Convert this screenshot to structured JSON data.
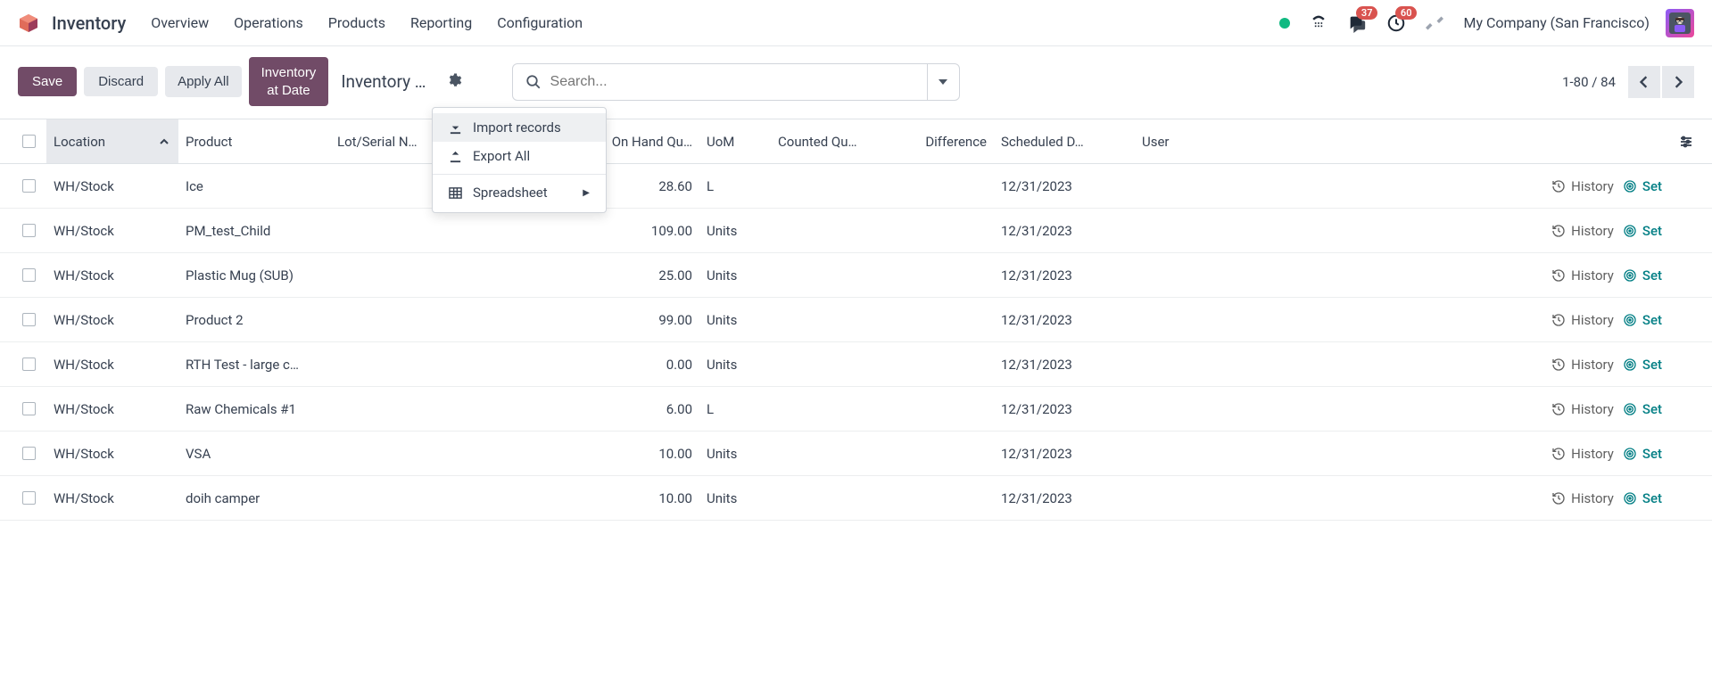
{
  "app_title": "Inventory",
  "nav": [
    "Overview",
    "Operations",
    "Products",
    "Reporting",
    "Configuration"
  ],
  "badges": {
    "messages": "37",
    "activities": "60"
  },
  "company": "My Company (San Francisco)",
  "toolbar": {
    "save": "Save",
    "discard": "Discard",
    "apply_all": "Apply All",
    "inventory_at_date": "Inventory at Date",
    "breadcrumb": "Inventory …"
  },
  "search": {
    "placeholder": "Search..."
  },
  "pager": {
    "text": "1-80 / 84"
  },
  "dropdown": {
    "import": "Import records",
    "export": "Export All",
    "spreadsheet": "Spreadsheet"
  },
  "columns": {
    "location": "Location",
    "product": "Product",
    "lot": "Lot/Serial N…",
    "onhand": "On Hand Qu…",
    "uom": "UoM",
    "counted": "Counted Qu…",
    "difference": "Difference",
    "scheduled": "Scheduled D…",
    "user": "User"
  },
  "row_actions": {
    "history": "History",
    "set": "Set"
  },
  "rows": [
    {
      "location": "WH/Stock",
      "product": "Ice",
      "qty": "28.60",
      "uom": "L",
      "date": "12/31/2023"
    },
    {
      "location": "WH/Stock",
      "product": "PM_test_Child",
      "qty": "109.00",
      "uom": "Units",
      "date": "12/31/2023"
    },
    {
      "location": "WH/Stock",
      "product": "Plastic Mug (SUB)",
      "qty": "25.00",
      "uom": "Units",
      "date": "12/31/2023"
    },
    {
      "location": "WH/Stock",
      "product": "Product 2",
      "qty": "99.00",
      "uom": "Units",
      "date": "12/31/2023"
    },
    {
      "location": "WH/Stock",
      "product": "RTH Test - large c…",
      "qty": "0.00",
      "uom": "Units",
      "date": "12/31/2023"
    },
    {
      "location": "WH/Stock",
      "product": "Raw Chemicals #1",
      "qty": "6.00",
      "uom": "L",
      "date": "12/31/2023"
    },
    {
      "location": "WH/Stock",
      "product": "VSA",
      "qty": "10.00",
      "uom": "Units",
      "date": "12/31/2023"
    },
    {
      "location": "WH/Stock",
      "product": "doih camper",
      "qty": "10.00",
      "uom": "Units",
      "date": "12/31/2023"
    }
  ]
}
